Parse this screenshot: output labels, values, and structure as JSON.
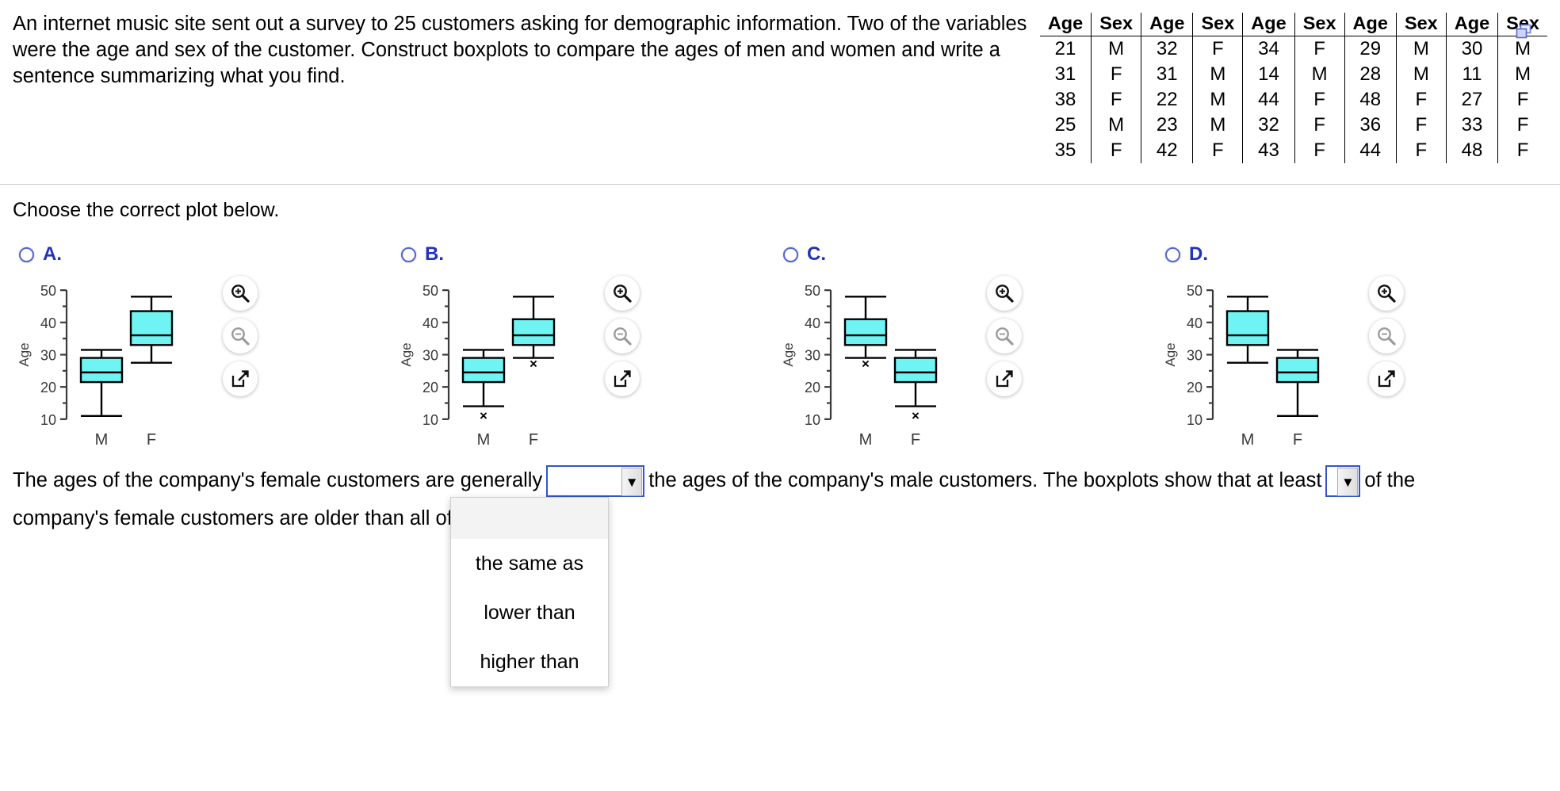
{
  "question": {
    "text": "An internet music site sent out a survey to 25 customers asking for demographic information. Two of the variables were the age and sex of the customer. Construct boxplots to compare the ages of men and women and write a sentence summarizing what you find."
  },
  "data_table": {
    "headers": [
      "Age",
      "Sex",
      "Age",
      "Sex",
      "Age",
      "Sex",
      "Age",
      "Sex",
      "Age",
      "Sex"
    ],
    "rows": [
      [
        "21",
        "M",
        "32",
        "F",
        "34",
        "F",
        "29",
        "M",
        "30",
        "M"
      ],
      [
        "31",
        "F",
        "31",
        "M",
        "14",
        "M",
        "28",
        "M",
        "11",
        "M"
      ],
      [
        "38",
        "F",
        "22",
        "M",
        "44",
        "F",
        "48",
        "F",
        "27",
        "F"
      ],
      [
        "25",
        "M",
        "23",
        "M",
        "32",
        "F",
        "36",
        "F",
        "33",
        "F"
      ],
      [
        "35",
        "F",
        "42",
        "F",
        "43",
        "F",
        "44",
        "F",
        "48",
        "F"
      ]
    ],
    "copy_icon": "copy-icon"
  },
  "instruction": {
    "choose_label": "Choose the correct plot below."
  },
  "plot_tools": {
    "zoom_in_icon": "zoom-in-icon",
    "zoom_out_icon": "zoom-out-icon",
    "popout_icon": "popout-icon"
  },
  "colors": {
    "box_fill": "#6ff3f3",
    "accent_blue": "#2233bb",
    "radio_border": "#5566cc",
    "axis": "#3a3a3a"
  },
  "chart_data": [
    {
      "id": "A",
      "label": "A.",
      "type": "boxplot",
      "ylabel": "Age",
      "ylim": [
        8,
        52
      ],
      "yticks": [
        10,
        20,
        30,
        40,
        50
      ],
      "minor_ticks": [
        15,
        25,
        35,
        45
      ],
      "categories": [
        "M",
        "F"
      ],
      "boxes": [
        {
          "category": "M",
          "min": 11,
          "q1": 21.5,
          "median": 24.5,
          "q3": 29,
          "max": 31.5,
          "outliers": []
        },
        {
          "category": "F",
          "min": 27.5,
          "q1": 33,
          "median": 36,
          "q3": 43.5,
          "max": 48,
          "outliers": []
        }
      ]
    },
    {
      "id": "B",
      "label": "B.",
      "type": "boxplot",
      "ylabel": "Age",
      "ylim": [
        8,
        52
      ],
      "yticks": [
        10,
        20,
        30,
        40,
        50
      ],
      "minor_ticks": [
        15,
        25,
        35,
        45
      ],
      "categories": [
        "M",
        "F"
      ],
      "boxes": [
        {
          "category": "M",
          "min": 14,
          "q1": 21.5,
          "median": 24.5,
          "q3": 29,
          "max": 31.5,
          "outliers": [
            11
          ]
        },
        {
          "category": "F",
          "min": 29,
          "q1": 33,
          "median": 36,
          "q3": 41,
          "max": 48,
          "outliers": [
            27
          ]
        }
      ]
    },
    {
      "id": "C",
      "label": "C.",
      "type": "boxplot",
      "ylabel": "Age",
      "ylim": [
        8,
        52
      ],
      "yticks": [
        10,
        20,
        30,
        40,
        50
      ],
      "minor_ticks": [
        15,
        25,
        35,
        45
      ],
      "categories": [
        "M",
        "F"
      ],
      "boxes": [
        {
          "category": "M",
          "min": 29,
          "q1": 33,
          "median": 36,
          "q3": 41,
          "max": 48,
          "outliers": [
            27
          ]
        },
        {
          "category": "F",
          "min": 14,
          "q1": 21.5,
          "median": 24.5,
          "q3": 29,
          "max": 31.5,
          "outliers": [
            11
          ]
        }
      ]
    },
    {
      "id": "D",
      "label": "D.",
      "type": "boxplot",
      "ylabel": "Age",
      "ylim": [
        8,
        52
      ],
      "yticks": [
        10,
        20,
        30,
        40,
        50
      ],
      "minor_ticks": [
        15,
        25,
        35,
        45
      ],
      "categories": [
        "M",
        "F"
      ],
      "boxes": [
        {
          "category": "M",
          "min": 27.5,
          "q1": 33,
          "median": 36,
          "q3": 43.5,
          "max": 48,
          "outliers": []
        },
        {
          "category": "F",
          "min": 11,
          "q1": 21.5,
          "median": 24.5,
          "q3": 29,
          "max": 31.5,
          "outliers": []
        }
      ]
    }
  ],
  "answer": {
    "line1_part1": "The ages of the company's female customers are generally",
    "line1_part2": "the ages of the company's male customers. The boxplots show that at least",
    "line1_part3": "of the",
    "line2": "company's female customers are older than all of the male c",
    "dropdown1_value": "",
    "dropdown2_value": "",
    "arrow_glyph": "▼"
  },
  "dropdown_menu": {
    "options": [
      "",
      "the same as",
      "lower than",
      "higher than"
    ]
  }
}
